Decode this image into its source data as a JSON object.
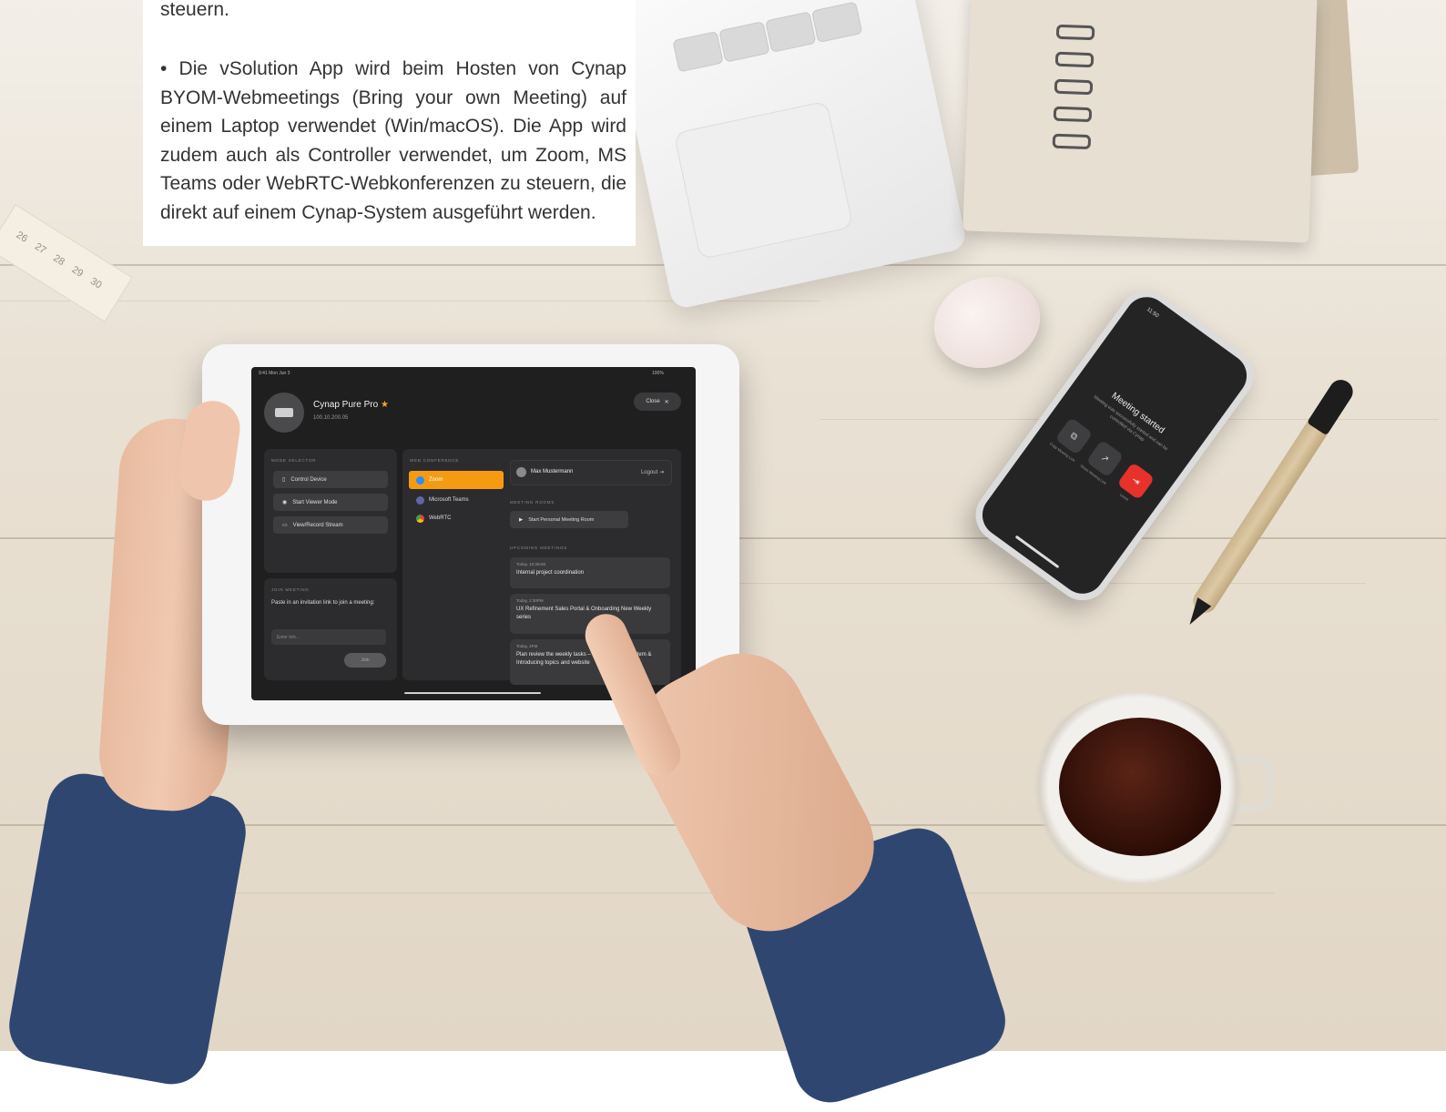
{
  "article": {
    "line_top": "steuern.",
    "paragraph": "• Die vSolution App wird beim Hosten von Cynap BYOM-Webmeetings (Bring your own Meeting) auf einem Laptop verwendet (Win/macOS). Die App wird zudem auch als Controller verwendet, um Zoom, MS Teams oder WebRTC-Webkonferenzen zu steuern, die direkt auf einem Cynap-System ausgeführt werden."
  },
  "ruler": {
    "ticks": [
      "26",
      "27",
      "28",
      "29",
      "30"
    ]
  },
  "tablet": {
    "status_time": "9:41 Mon Jun 3",
    "status_right": "100%",
    "device": {
      "name": "Cynap Pure Pro",
      "star": "★",
      "ip": "100.10.200.05"
    },
    "close_label": "Close",
    "mode_selector": {
      "label": "MODE SELECTOR",
      "buttons": [
        "Control Device",
        "Start Viewer Mode",
        "View/Record Stream"
      ]
    },
    "join_meeting": {
      "label": "JOIN MEETING",
      "text": "Paste in an invitation link to join a meeting:",
      "placeholder": "Enter link...",
      "join_label": "Join"
    },
    "web_conference": {
      "label": "WEB CONFERENCE",
      "items": [
        "Zoom",
        "Microsoft Teams",
        "WebRTC"
      ]
    },
    "user": {
      "name": "Max Mustermann",
      "logout_label": "Logout"
    },
    "meeting_rooms": {
      "label": "MEETING ROOMS",
      "start_label": "Start Personal Meeting Room"
    },
    "upcoming": {
      "label": "UPCOMING MEETINGS",
      "meetings": [
        {
          "time": "Today, 10:30AM",
          "name": "Internal project coordination"
        },
        {
          "time": "Today, 2:30PM",
          "name": "UX Refinement Sales Portal & Onboarding New Weekly series"
        },
        {
          "time": "Today, 4PM",
          "name": "Plan review the weekly tasks – Update design system & Introducing topics and website"
        }
      ]
    }
  },
  "phone": {
    "time": "11:50",
    "title": "Meeting started",
    "subtitle": "Meeting was successfully started and can be controlled via Cynap",
    "buttons": [
      "Copy Meeting Link",
      "Share Meeting Link",
      "Leave"
    ]
  },
  "colors": {
    "accent": "#f59b12",
    "leave_red": "#e8312b",
    "screen_bg": "#1f1f20",
    "panel_bg": "#2c2c2e",
    "star": "#f5a623"
  }
}
